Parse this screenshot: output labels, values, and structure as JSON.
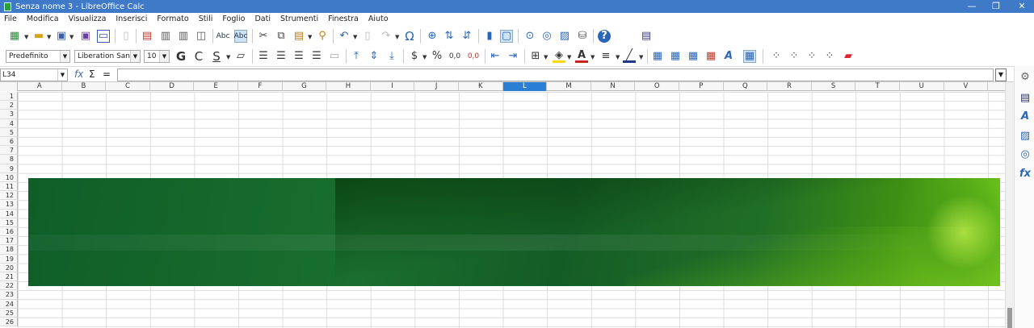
{
  "window": {
    "title": "Senza nome 3 - LibreOffice Calc",
    "minimize": "—",
    "restore": "❐",
    "close": "✕"
  },
  "menu": [
    "File",
    "Modifica",
    "Visualizza",
    "Inserisci",
    "Formato",
    "Stili",
    "Foglio",
    "Dati",
    "Strumenti",
    "Finestra",
    "Aiuto"
  ],
  "formatting": {
    "style": "Predefinito",
    "font": "Liberation Sans",
    "size": "10"
  },
  "formula": {
    "cell_ref": "L34",
    "fx": "fx",
    "sigma": "Σ",
    "equals": "="
  },
  "columns": [
    "A",
    "B",
    "C",
    "D",
    "E",
    "F",
    "G",
    "H",
    "I",
    "J",
    "K",
    "L",
    "M",
    "N",
    "O",
    "P",
    "Q",
    "R",
    "S",
    "T",
    "U",
    "V"
  ],
  "selected_column": "L",
  "rows": [
    "1",
    "2",
    "3",
    "4",
    "5",
    "6",
    "7",
    "8",
    "9",
    "10",
    "11",
    "12",
    "13",
    "14",
    "15",
    "16",
    "17",
    "18",
    "19",
    "20",
    "21",
    "22",
    "23",
    "24",
    "25",
    "26"
  ],
  "icons": {
    "new": "🗋",
    "open": "📂",
    "save": "💾",
    "export_pdf": "⎙",
    "print": "🖶",
    "print_preview": "🔍",
    "spelling": "Abc",
    "cut": "✂",
    "copy": "⧉",
    "paste": "📋",
    "clone": "🖌",
    "undo": "↶",
    "redo": "↷",
    "special_char": "Ω",
    "chart": "📊",
    "help": "?",
    "bold": "G",
    "italic": "C",
    "underline": "S",
    "currency": "$",
    "percent": "%",
    "decimal": "0,0",
    "font_color": "A",
    "styles": "A"
  }
}
